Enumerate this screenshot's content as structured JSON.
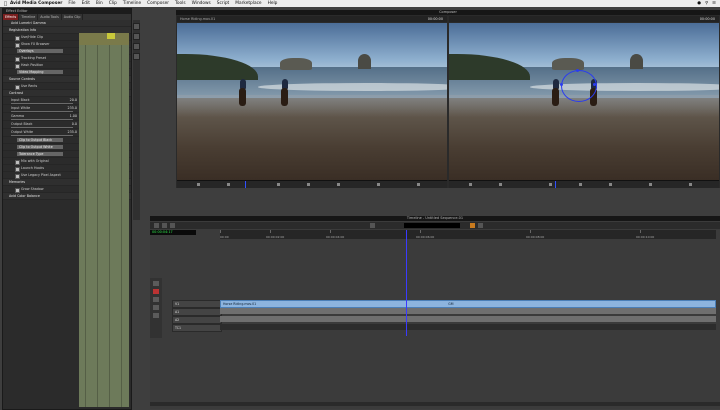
{
  "menubar": {
    "app": "Avid Media Composer",
    "items": [
      "File",
      "Edit",
      "Bin",
      "Clip",
      "Timeline",
      "Composer",
      "Tools",
      "Windows",
      "Script",
      "Marketplace",
      "Help"
    ]
  },
  "effect_editor": {
    "title": "Effect Editor",
    "tabs": [
      "Effects",
      "Timeline",
      "Audio Tools",
      "Audio Clip"
    ],
    "effect_name": "Avid Lumetri Gamma",
    "params": [
      {
        "label": "Registration Info",
        "type": "section"
      },
      {
        "label": "Use/Hide Clip",
        "type": "check"
      },
      {
        "label": "Show FX Browser",
        "type": "check"
      },
      {
        "label": "Overlays",
        "type": "button"
      },
      {
        "label": "Tracking Preset",
        "type": "check"
      },
      {
        "label": "Hash Position",
        "type": "check"
      },
      {
        "label": "Video Mapping",
        "type": "button"
      },
      {
        "label": "Source Controls",
        "type": "section"
      },
      {
        "label": "Use Rects",
        "type": "check"
      },
      {
        "label": "Contrast",
        "type": "section"
      },
      {
        "label": "Input Black",
        "type": "slider",
        "value": "20.0"
      },
      {
        "label": "Input White",
        "type": "slider",
        "value": "235.0"
      },
      {
        "label": "Gamma",
        "type": "slider",
        "value": "1.00"
      },
      {
        "label": "Output Black",
        "type": "slider",
        "value": "0.0"
      },
      {
        "label": "Output White",
        "type": "slider",
        "value": "235.0"
      },
      {
        "label": "Clip to Output Black",
        "type": "button"
      },
      {
        "label": "Clip to Output White",
        "type": "button"
      },
      {
        "label": "Tolerance Type",
        "type": "button"
      },
      {
        "label": "Mix with Original",
        "type": "check"
      },
      {
        "label": "Launch Hooks",
        "type": "check"
      },
      {
        "label": "Use Legacy Pixel Aspect",
        "type": "check"
      },
      {
        "label": "Memories",
        "type": "section"
      },
      {
        "label": "Grow Shadow",
        "type": "check"
      },
      {
        "label": "Avid Color Balance",
        "type": "section"
      }
    ]
  },
  "composer": {
    "title": "Composer",
    "source": {
      "clip": "Horse Riding.mov.01",
      "tc": "00:00:00"
    },
    "record": {
      "clip": "",
      "tc": "00:00:00"
    }
  },
  "timeline": {
    "title": "Timeline - Untitled Sequence.01",
    "master_tc": "00:00:04:17",
    "ruler": [
      "00:00",
      "00:00:02:00",
      "00:00:04:00",
      "00:00:06:00",
      "00:00:08:00",
      "00:00:10:00"
    ],
    "tracks": [
      {
        "name": "V1",
        "clip": "Horse Riding.mov.01",
        "fx": "GM"
      },
      {
        "name": "A1",
        "clip": ""
      },
      {
        "name": "A2",
        "clip": ""
      },
      {
        "name": "TC1",
        "clip": ""
      }
    ]
  }
}
